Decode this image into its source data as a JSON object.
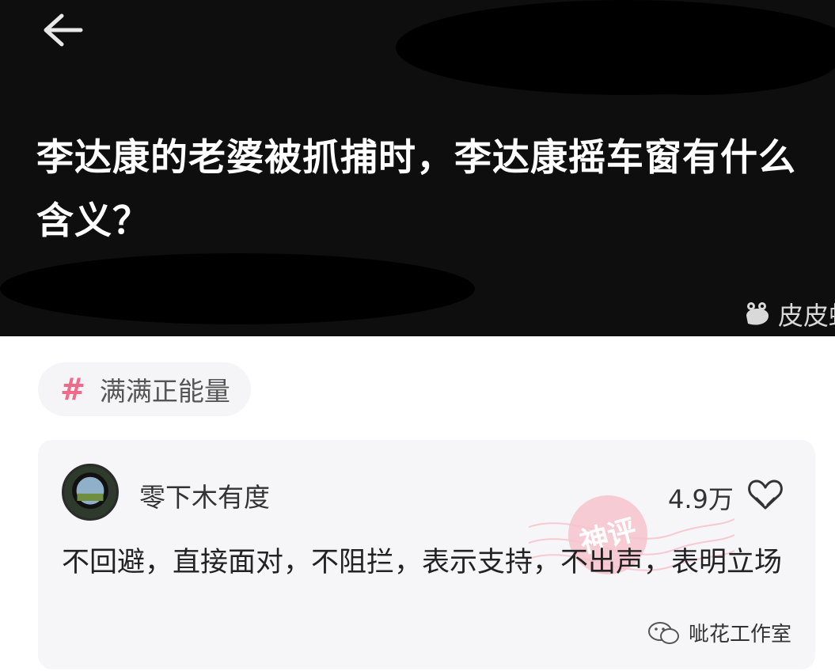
{
  "header": {
    "question_title": "李达康的老婆被抓捕时，李达康摇车窗有什么含义？",
    "brand_name": "皮皮虾"
  },
  "topic": {
    "label": "满满正能量"
  },
  "comment": {
    "username": "零下木有度",
    "like_count": "4.9万",
    "text": "不回避，直接面对，不阻拦，表示支持，不出声，表明立场",
    "stamp_label": "神评"
  },
  "watermark": {
    "text": "呲花工作室"
  },
  "colors": {
    "hero_bg": "#0e0e0e",
    "accent_pink": "#f06b8a",
    "card_bg": "#f6f6f8"
  },
  "icons": {
    "back": "back-arrow-icon",
    "hash": "hashtag-icon",
    "like": "heart-like-icon",
    "brand": "pipixia-logo",
    "watermark": "wechat-icon"
  }
}
